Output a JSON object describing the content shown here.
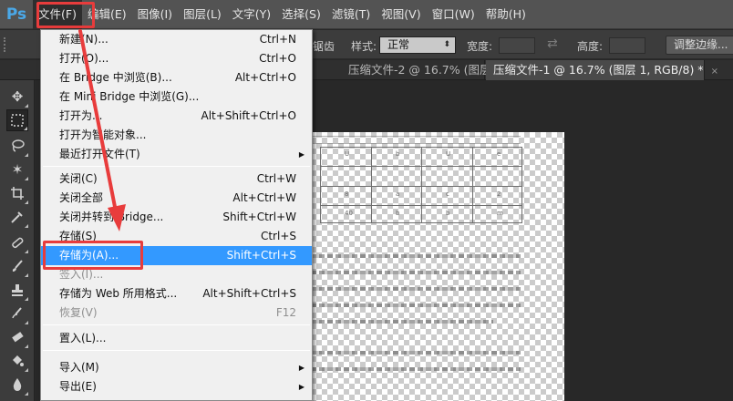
{
  "menubar": {
    "logo": "Ps",
    "items": [
      {
        "label": "文件(F)",
        "active": true
      },
      {
        "label": "编辑(E)"
      },
      {
        "label": "图像(I)"
      },
      {
        "label": "图层(L)"
      },
      {
        "label": "文字(Y)"
      },
      {
        "label": "选择(S)"
      },
      {
        "label": "滤镜(T)"
      },
      {
        "label": "视图(V)"
      },
      {
        "label": "窗口(W)"
      },
      {
        "label": "帮助(H)"
      }
    ]
  },
  "options_bar": {
    "partial_label": "锯齿",
    "style_label": "样式:",
    "style_value": "正常",
    "width_label": "宽度:",
    "height_label": "高度:",
    "refine_button": "调整边缘..."
  },
  "tabs": [
    {
      "label": "压缩文件-2 @ 16.7% (图层 1, RGB/8)",
      "close": "×",
      "active": false
    },
    {
      "label": "压缩文件-1 @ 16.7% (图层 1, RGB/8) *",
      "close": "×",
      "active": true
    }
  ],
  "file_menu": {
    "items": [
      {
        "label": "新建(N)...",
        "shortcut": "Ctrl+N"
      },
      {
        "label": "打开(O)...",
        "shortcut": "Ctrl+O"
      },
      {
        "label": "在 Bridge 中浏览(B)...",
        "shortcut": "Alt+Ctrl+O"
      },
      {
        "label": "在 Mini Bridge 中浏览(G)...",
        "shortcut": ""
      },
      {
        "label": "打开为...",
        "shortcut": "Alt+Shift+Ctrl+O"
      },
      {
        "label": "打开为智能对象...",
        "shortcut": ""
      },
      {
        "label": "最近打开文件(T)",
        "shortcut": "",
        "submenu": true
      },
      {
        "label": "关闭(C)",
        "shortcut": "Ctrl+W"
      },
      {
        "label": "关闭全部",
        "shortcut": "Alt+Ctrl+W"
      },
      {
        "label": "关闭并转到 Bridge...",
        "shortcut": "Shift+Ctrl+W"
      },
      {
        "label": "存储(S)",
        "shortcut": "Ctrl+S"
      },
      {
        "label": "存储为(A)...",
        "shortcut": "Shift+Ctrl+S",
        "highlighted": true
      },
      {
        "label": "签入(I)...",
        "shortcut": "",
        "disabled": true
      },
      {
        "label": "存储为 Web 所用格式...",
        "shortcut": "Alt+Shift+Ctrl+S"
      },
      {
        "label": "恢复(V)",
        "shortcut": "F12",
        "disabled": true
      },
      {
        "label": "置入(L)...",
        "shortcut": ""
      },
      {
        "label": "导入(M)",
        "shortcut": "",
        "submenu": true
      },
      {
        "label": "导出(E)",
        "shortcut": "",
        "submenu": true
      }
    ],
    "submenu_glyph": "▶"
  },
  "document": {
    "table_cells": [
      "U",
      "b",
      "U",
      "e",
      "",
      "",
      "",
      "",
      "8",
      "a",
      "c",
      "2",
      "40",
      "b",
      "b",
      "m"
    ]
  },
  "colors": {
    "menubar_bg": "#535353",
    "menu_highlight": "#3399ff",
    "annotation_red": "#e83c3c",
    "logo_blue": "#4aa8e8"
  }
}
